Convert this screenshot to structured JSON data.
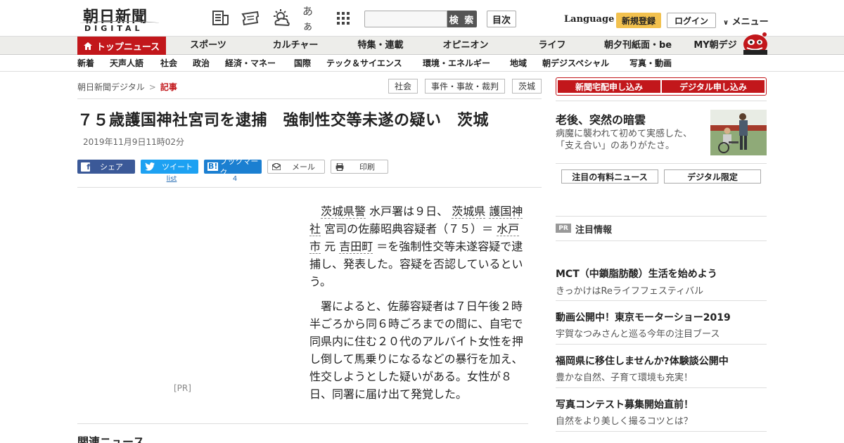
{
  "header": {
    "logo_main": "朝日新聞",
    "logo_sub": "DIGITAL",
    "search_button": "検 索",
    "toc_button": "目次",
    "language": "Language",
    "register": "新規登録",
    "login": "ログイン",
    "menu": "メニュー",
    "kana_icon_text": "あぁ"
  },
  "nav1": {
    "top_news": "トップニュース",
    "items": [
      "スポーツ",
      "カルチャー",
      "特集・連載",
      "オピニオン",
      "ライフ",
      "朝夕刊紙面・be",
      "MY朝デジ"
    ]
  },
  "nav2": {
    "items": [
      "新着",
      "天声人語",
      "社会",
      "政治",
      "経済・マネー",
      "国際",
      "テック＆サイエンス",
      "環境・エネルギー",
      "地域",
      "朝デジスペシャル",
      "写真・動画"
    ]
  },
  "breadcrumb": {
    "root": "朝日新聞デジタル",
    "sep": ">",
    "current": "記事"
  },
  "tags": [
    "社会",
    "事件・事故・裁判",
    "茨城"
  ],
  "article": {
    "title": "７５歳護国神社宮司を逮捕　強制性交等未遂の疑い　茨城",
    "date": "2019年11月9日11時02分",
    "pr_label": "[PR]",
    "p1_parts": [
      "茨城県警",
      " 水戸署は９日、 ",
      "茨城県",
      " ",
      "護国神社",
      " 宮司の佐藤昭典容疑者（７５）＝ ",
      "水戸市",
      " 元 ",
      "吉田町",
      " ＝を強制性交等未遂容疑で逮捕し、発表した。容疑を否認しているという。"
    ],
    "p2": "署によると、佐藤容疑者は７日午後２時半ごろから同６時ごろまでの間に、自宅で同県内に住む２０代のアルバイト女性を押し倒して馬乗りになるなどの暴行を加え、性交しようとした疑いがある。女性が８日、同署に届け出て発覚した。",
    "related_heading": "関連ニュース"
  },
  "share": {
    "facebook": "シェア",
    "twitter": "ツイート",
    "twitter_count": "list",
    "hatena": "ブックマーク",
    "hatena_count": "4",
    "mail": "メール",
    "print": "印刷"
  },
  "sidebar": {
    "subscribe_paper": "新聞宅配申し込み",
    "subscribe_digital": "デジタル申し込み",
    "feature_title": "老後、突然の暗雲",
    "feature_desc": "病魔に襲われて初めて実感した、「支え合い」のありがたさ。",
    "btn_paid_news": "注目の有料ニュース",
    "btn_digital_only": "デジタル限定",
    "pr_badge": "PR",
    "pr_heading": "注目情報",
    "pr_items": [
      {
        "title": "MCT（中鎖脂肪酸）生活を始めよう",
        "sub": "きっかけはReライフフェスティバル"
      },
      {
        "title": "動画公開中！東京モーターショー2019",
        "sub": "宇賀なつみさんと巡る今年の注目ブース"
      },
      {
        "title": "福岡県に移住しませんか?体験談公開中",
        "sub": "豊かな自然、子育て環境も充実！"
      },
      {
        "title": "写真コンテスト募集開始直前！",
        "sub": "自然をより美しく撮るコツとは？"
      }
    ]
  },
  "colors": {
    "brand_red": "#c2171b",
    "register_yellow": "#f2c14e",
    "facebook_blue": "#3b5998",
    "twitter_blue": "#1da1f2",
    "hatena_blue": "#1b7fd1"
  }
}
